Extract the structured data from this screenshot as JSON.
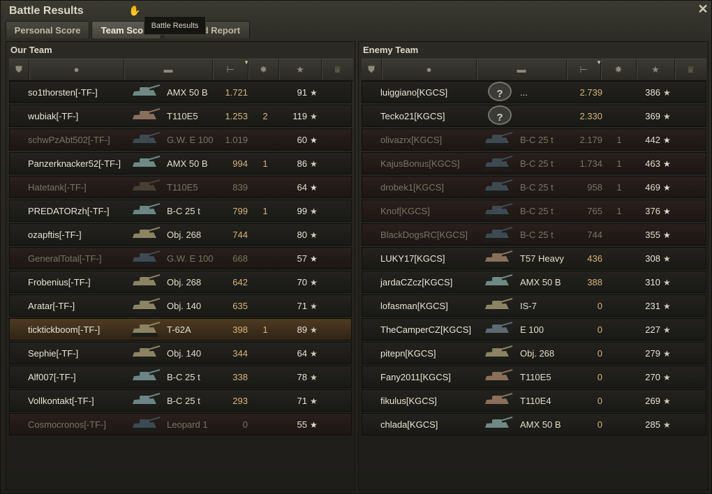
{
  "window": {
    "title": "Battle Results"
  },
  "tabs": [
    {
      "label": "Personal Score"
    },
    {
      "label": "Team Score"
    },
    {
      "label": "Detailed Report"
    }
  ],
  "tooltip": "Battle Results",
  "our_team": {
    "title": "Our Team",
    "rows": [
      {
        "player": "so1thorsten[-TF-]",
        "tank": "AMX 50 B",
        "damage": "1.721",
        "kills": "",
        "xp": "91",
        "status": "alive",
        "tank_color": "#6f8a85"
      },
      {
        "player": "wubiak[-TF-]",
        "tank": "T110E5",
        "damage": "1.253",
        "kills": "2",
        "xp": "119",
        "status": "alive",
        "tank_color": "#8a6f5a"
      },
      {
        "player": "schwPzAbt502[-TF-]",
        "tank": "G.W. E 100",
        "damage": "1.019",
        "kills": "",
        "xp": "60",
        "status": "dead",
        "tank_color": "#3d4a52"
      },
      {
        "player": "Panzerknacker52[-TF-]",
        "tank": "AMX 50 B",
        "damage": "994",
        "kills": "1",
        "xp": "86",
        "status": "alive",
        "tank_color": "#6f8a85"
      },
      {
        "player": "Hatetank[-TF-]",
        "tank": "T110E5",
        "damage": "839",
        "kills": "",
        "xp": "64",
        "status": "dead",
        "tank_color": "#4a3d33"
      },
      {
        "player": "PREDATORzh[-TF-]",
        "tank": "B-C 25 t",
        "damage": "799",
        "kills": "1",
        "xp": "99",
        "status": "alive",
        "tank_color": "#6b8585"
      },
      {
        "player": "ozapftis[-TF-]",
        "tank": "Obj. 268",
        "damage": "744",
        "kills": "",
        "xp": "80",
        "status": "alive",
        "tank_color": "#8a8462"
      },
      {
        "player": "GeneralTotal[-TF-]",
        "tank": "G.W. E 100",
        "damage": "668",
        "kills": "",
        "xp": "57",
        "status": "dead",
        "tank_color": "#3d4a52"
      },
      {
        "player": "Frobenius[-TF-]",
        "tank": "Obj. 268",
        "damage": "642",
        "kills": "",
        "xp": "70",
        "status": "alive",
        "tank_color": "#8a8462"
      },
      {
        "player": "Aratar[-TF-]",
        "tank": "Obj. 140",
        "damage": "635",
        "kills": "",
        "xp": "71",
        "status": "alive",
        "tank_color": "#8a8462"
      },
      {
        "player": "ticktickboom[-TF-]",
        "tank": "T-62A",
        "damage": "398",
        "kills": "1",
        "xp": "89",
        "status": "me",
        "tank_color": "#8a8462"
      },
      {
        "player": "Sephie[-TF-]",
        "tank": "Obj. 140",
        "damage": "344",
        "kills": "",
        "xp": "64",
        "status": "alive",
        "tank_color": "#8a8462"
      },
      {
        "player": "Alf007[-TF-]",
        "tank": "B-C 25 t",
        "damage": "338",
        "kills": "",
        "xp": "78",
        "status": "alive",
        "tank_color": "#6b8585"
      },
      {
        "player": "Vollkontakt[-TF-]",
        "tank": "B-C 25 t",
        "damage": "293",
        "kills": "",
        "xp": "71",
        "status": "alive",
        "tank_color": "#6b8585"
      },
      {
        "player": "Cosmocronos[-TF-]",
        "tank": "Leopard 1",
        "damage": "0",
        "kills": "",
        "xp": "55",
        "status": "dead",
        "tank_color": "#3d4a52"
      }
    ]
  },
  "enemy_team": {
    "title": "Enemy Team",
    "rows": [
      {
        "player": "luiggiano[KGCS]",
        "tank": "...",
        "damage": "2.739",
        "kills": "",
        "xp": "386",
        "status": "alive",
        "unknown": true
      },
      {
        "player": "Tecko21[KGCS]",
        "tank": "",
        "damage": "2.330",
        "kills": "",
        "xp": "369",
        "status": "alive",
        "unknown": true
      },
      {
        "player": "olivazrx[KGCS]",
        "tank": "B-C 25 t",
        "damage": "2.179",
        "kills": "1",
        "xp": "442",
        "status": "dead",
        "tank_color": "#3d4a52"
      },
      {
        "player": "KajusBonus[KGCS]",
        "tank": "B-C 25 t",
        "damage": "1.734",
        "kills": "1",
        "xp": "463",
        "status": "dead",
        "tank_color": "#3d4a52"
      },
      {
        "player": "drobek1[KGCS]",
        "tank": "B-C 25 t",
        "damage": "958",
        "kills": "1",
        "xp": "469",
        "status": "dead",
        "tank_color": "#3d4a52"
      },
      {
        "player": "Knof[KGCS]",
        "tank": "B-C 25 t",
        "damage": "765",
        "kills": "1",
        "xp": "376",
        "status": "dead",
        "tank_color": "#3d4a52"
      },
      {
        "player": "BlackDogsRC[KGCS]",
        "tank": "B-C 25 t",
        "damage": "744",
        "kills": "",
        "xp": "355",
        "status": "dead",
        "tank_color": "#3d4a52"
      },
      {
        "player": "LUKY17[KGCS]",
        "tank": "T57 Heavy",
        "damage": "436",
        "kills": "",
        "xp": "308",
        "status": "alive",
        "tank_color": "#8a6f5a"
      },
      {
        "player": "jardaCZcz[KGCS]",
        "tank": "AMX 50 B",
        "damage": "388",
        "kills": "",
        "xp": "310",
        "status": "alive",
        "tank_color": "#6f8a85"
      },
      {
        "player": "lofasman[KGCS]",
        "tank": "IS-7",
        "damage": "0",
        "kills": "",
        "xp": "231",
        "status": "alive",
        "tank_color": "#8a8462"
      },
      {
        "player": "TheCamperCZ[KGCS]",
        "tank": "E 100",
        "damage": "0",
        "kills": "",
        "xp": "227",
        "status": "alive",
        "tank_color": "#5c6a74"
      },
      {
        "player": "pitepn[KGCS]",
        "tank": "Obj. 268",
        "damage": "0",
        "kills": "",
        "xp": "279",
        "status": "alive",
        "tank_color": "#8a8462"
      },
      {
        "player": "Fany2011[KGCS]",
        "tank": "T110E5",
        "damage": "0",
        "kills": "",
        "xp": "270",
        "status": "alive",
        "tank_color": "#8a6f5a"
      },
      {
        "player": "fikulus[KGCS]",
        "tank": "T110E4",
        "damage": "0",
        "kills": "",
        "xp": "269",
        "status": "alive",
        "tank_color": "#8a6f5a"
      },
      {
        "player": "chlada[KGCS]",
        "tank": "AMX 50 B",
        "damage": "0",
        "kills": "",
        "xp": "285",
        "status": "alive",
        "tank_color": "#6f8a85"
      }
    ]
  },
  "columns": [
    "squad-icon",
    "player-icon",
    "tank-icon",
    "damage-icon",
    "kills-icon",
    "xp-star-icon",
    "medal-icon"
  ],
  "icons": {
    "star": "★",
    "unknown": "?",
    "close": "✕",
    "hand": "✋"
  }
}
